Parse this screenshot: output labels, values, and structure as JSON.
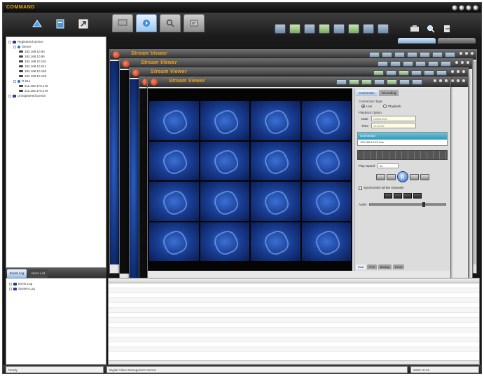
{
  "app": {
    "logo": "COMMAND",
    "window_controls": [
      "minimize",
      "restore",
      "maximize",
      "close"
    ]
  },
  "left_toolbar": {
    "icons": [
      "device-icon",
      "settings-icon",
      "export-icon"
    ]
  },
  "main_tabs": [
    {
      "name": "tab-monitor",
      "icon": "monitor-icon"
    },
    {
      "name": "tab-playback",
      "icon": "playback-icon"
    },
    {
      "name": "tab-search",
      "icon": "search-icon"
    },
    {
      "name": "tab-setup",
      "icon": "setup-icon"
    }
  ],
  "device_tree": {
    "root": "Registered Device",
    "groups": [
      {
        "name": "Server",
        "cameras": [
          "192.168.10.93",
          "192.168.10.95",
          "192.168.10.151",
          "192.168.10.211",
          "192.168.10.152",
          "192.168.10.153"
        ]
      },
      {
        "name": "R-614",
        "cameras": [
          "211.202.176.175",
          "211.202.176.176"
        ]
      }
    ],
    "unregistered": "Unregistered Device"
  },
  "log_tabs": [
    "Event Log",
    "Alarm List"
  ],
  "log_tree": [
    "Event Log",
    "System Log"
  ],
  "viewers": {
    "title": "Stream Viewer",
    "front_status": "Ready"
  },
  "control_panel": {
    "tabs": [
      "Connection",
      "Recording"
    ],
    "connection_type_label": "Connection Type",
    "radio_live": "Live",
    "radio_playback": "Playback",
    "playback_option_label": "Playback Option",
    "date_label": "Date",
    "date_value": "2008/10/26",
    "time_label": "Time",
    "time_value": "12:00:00",
    "list_selected": "Connected",
    "list_detail": "192.168.10.93    Live",
    "speed_label": "Play Speed",
    "speed_value": "1x",
    "sync_label": "Synchronize all the channels",
    "volume_label": "Audio",
    "bottom_tabs": [
      "Real",
      "PTZ",
      "Backup",
      "Event"
    ]
  },
  "statusbar": {
    "left": "Ready",
    "center": "Digital Video Management Server",
    "right": "2008-10-26"
  }
}
